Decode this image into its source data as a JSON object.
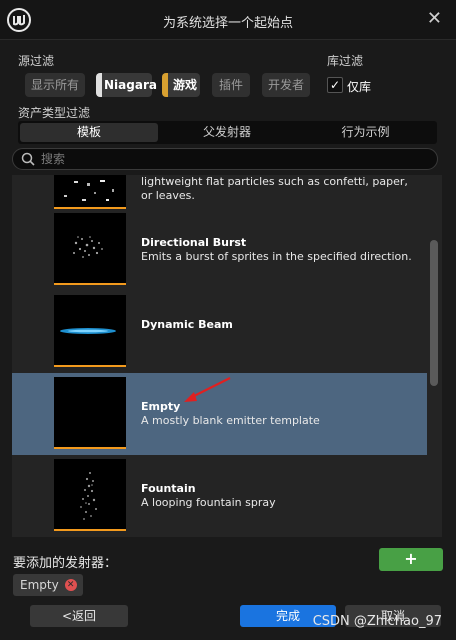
{
  "window": {
    "title": "为系统选择一个起始点",
    "close_icon": "close-icon",
    "logo": "unreal-logo-icon"
  },
  "source_filter": {
    "label": "源过滤",
    "chips": [
      {
        "label": "显示所有",
        "active": false,
        "color": ""
      },
      {
        "label": "Niagara",
        "active": true,
        "color": "#e0e0e0"
      },
      {
        "label": "游戏",
        "active": true,
        "color": "#d8a030"
      },
      {
        "label": "插件",
        "active": false,
        "color": ""
      },
      {
        "label": "开发者",
        "active": false,
        "color": ""
      }
    ]
  },
  "library_filter": {
    "label": "库过滤",
    "checkbox_label": "仅库",
    "checked": true
  },
  "asset_type_filter": {
    "label": "资产类型过滤",
    "tabs": [
      "模板",
      "父发射器",
      "行为示例"
    ],
    "selected_tab": "模板"
  },
  "search": {
    "placeholder": "搜索",
    "value": ""
  },
  "list": {
    "items": [
      {
        "title": "",
        "description": "lightweight flat particles such as confetti, paper, or leaves.",
        "selected": false
      },
      {
        "title": "Directional Burst",
        "description": "Emits a burst of sprites in the specified direction.",
        "selected": false
      },
      {
        "title": "Dynamic Beam",
        "description": "",
        "selected": false
      },
      {
        "title": "Empty",
        "description": "A mostly blank emitter template",
        "selected": true
      },
      {
        "title": "Fountain",
        "description": "A looping fountain spray",
        "selected": false
      }
    ]
  },
  "emitters_to_add": {
    "label": "要添加的发射器：",
    "add_label": "+",
    "items": [
      {
        "label": "Empty"
      }
    ]
  },
  "buttons": {
    "back": "<返回",
    "done": "完成",
    "cancel": "取消"
  },
  "watermark": "CSDN @Zhichao_97",
  "colors": {
    "accent": "#f39a1d",
    "selection": "#4d6680",
    "add_green": "#48a045",
    "primary_blue": "#1a74e0",
    "arrow_red": "#e02020"
  }
}
